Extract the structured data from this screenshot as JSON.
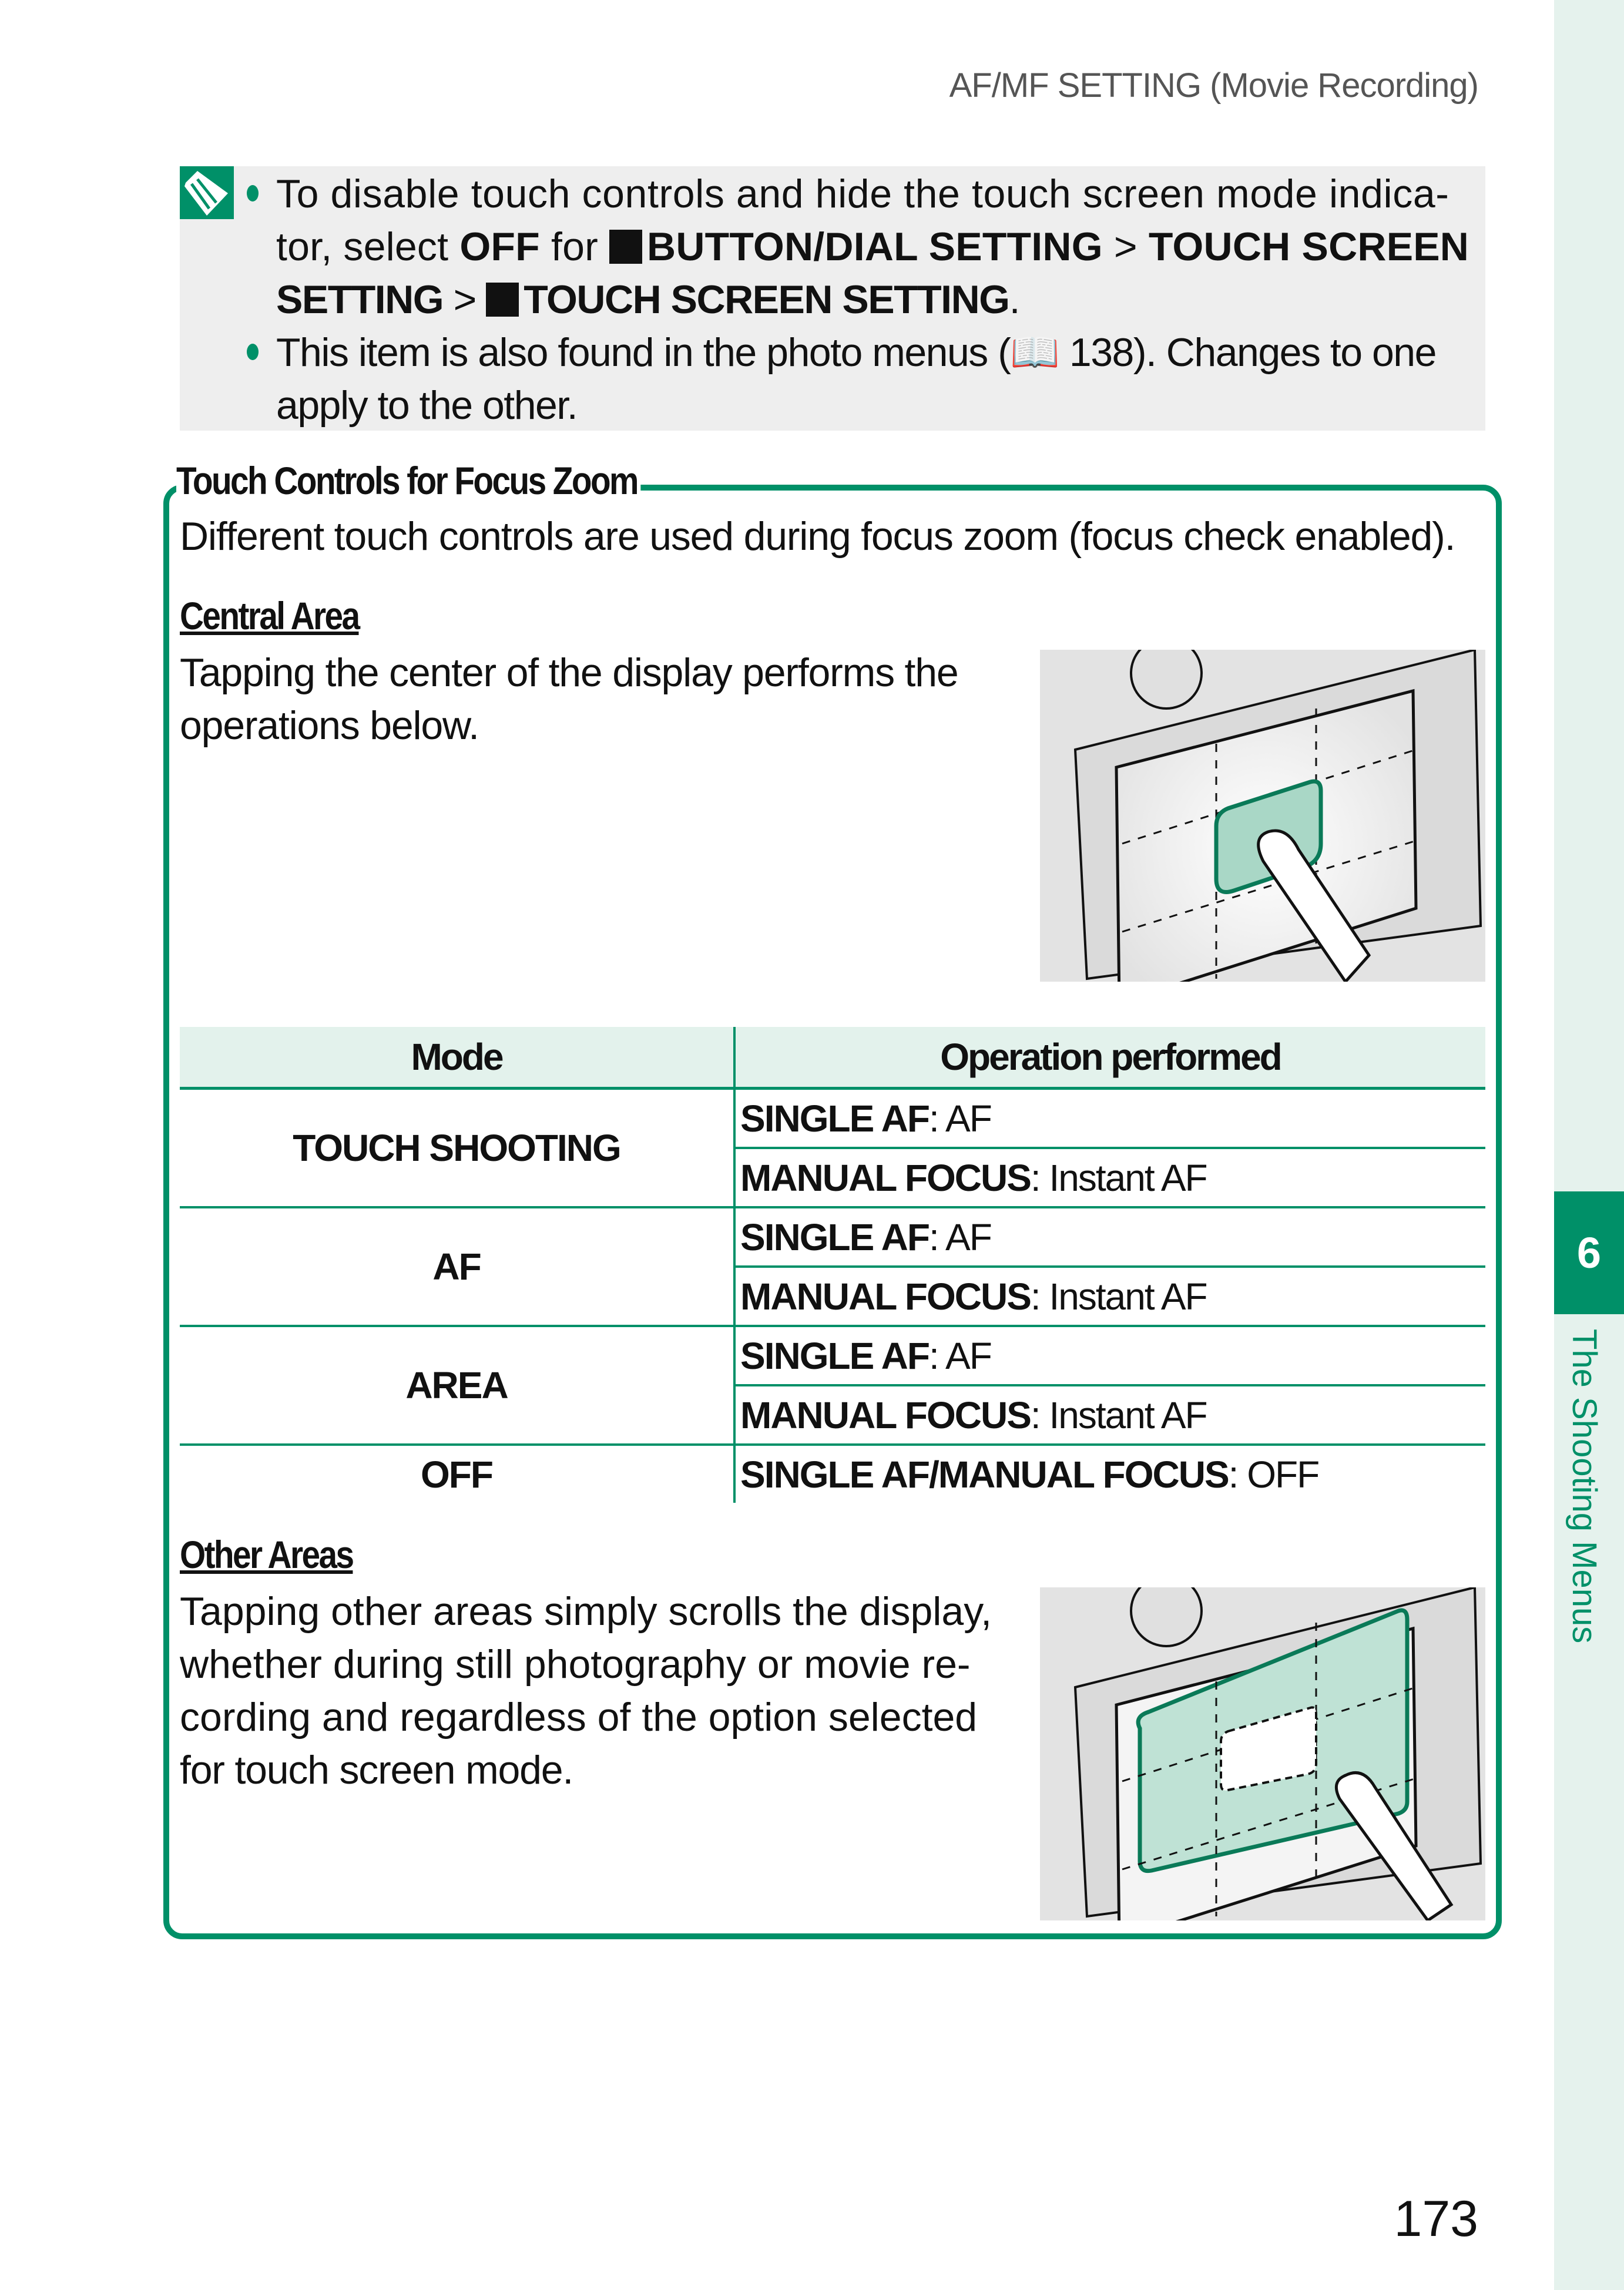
{
  "header": {
    "running_head": "AF/MF SETTING (Movie Recording)"
  },
  "sidebar": {
    "chapter_number": "6",
    "chapter_title": "The Shooting Menus"
  },
  "note": {
    "icon": "note-pencil-icon",
    "bullet1": {
      "line1": "To disable touch controls and hide the touch screen mode indica-",
      "line2_a": "tor, select ",
      "line2_off": "OFF",
      "line2_b": " for ",
      "line2_menu": "BUTTON/DIAL SETTING",
      "line2_sep": " > ",
      "line2_item": "TOUCH SCREEN",
      "line3_item": "SETTING",
      "line3_sep": " > ",
      "line3_sub": "TOUCH SCREEN SETTING",
      "line3_end": "."
    },
    "bullet2": {
      "line1_a": "This item is also found in the photo menus (",
      "line1_page": " 138). Changes to one",
      "line2": "apply to the other."
    }
  },
  "section": {
    "title": "Touch Controls for Focus Zoom",
    "intro": "Different touch controls are used during focus zoom (focus check enabled).",
    "central": {
      "heading": "Central Area",
      "line1": "Tapping the center of the display performs the",
      "line2": "operations below."
    },
    "table": {
      "headers": [
        "Mode",
        "Operation performed"
      ],
      "groups": [
        {
          "mode": "TOUCH SHOOTING",
          "ops": [
            {
              "label": "SINGLE AF",
              "value": ": AF"
            },
            {
              "label": "MANUAL FOCUS",
              "value": ": Instant AF"
            }
          ]
        },
        {
          "mode": "AF",
          "ops": [
            {
              "label": "SINGLE AF",
              "value": ": AF"
            },
            {
              "label": "MANUAL FOCUS",
              "value": ": Instant AF"
            }
          ]
        },
        {
          "mode": "AREA",
          "ops": [
            {
              "label": "SINGLE AF",
              "value": ": AF"
            },
            {
              "label": "MANUAL FOCUS",
              "value": ": Instant AF"
            }
          ]
        },
        {
          "mode": "OFF",
          "ops": [
            {
              "label": "SINGLE AF/MANUAL FOCUS",
              "value": ": OFF"
            }
          ]
        }
      ]
    },
    "other": {
      "heading": "Other Areas",
      "line1": "Tapping other areas simply scrolls the display,",
      "line2": "whether during still photography or movie re-",
      "line3": "cording and regardless of the option selected",
      "line4": "for touch screen mode."
    }
  },
  "colors": {
    "accent": "#009068",
    "note_bg": "#eeeeee",
    "table_header_bg": "#e3f2ec",
    "strip": "#e5f2ed"
  },
  "footer": {
    "page_number": "173"
  }
}
